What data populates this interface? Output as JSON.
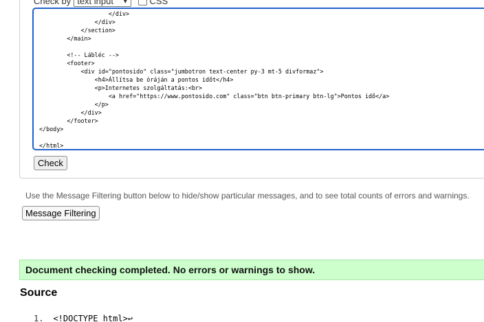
{
  "form": {
    "check_by_label": "Check by",
    "check_by_value": "text input",
    "css_label": "CSS",
    "check_button": "Check"
  },
  "code_lines": [
    "                    </div>",
    "                </div>",
    "            </section>",
    "        </main>",
    "",
    "        <!-- Lábléc -->",
    "        <footer>",
    "            <div id=\"pontosido\" class=\"jumbotron text-center py-3 mt-5 divformaz\">",
    "                <h4>Állítsa be óráján a pontos időt</h4>",
    "                <p>Internetes szolgáltatás:<br>",
    "                    <a href=\"https://www.pontosido.com\" class=\"btn btn-primary btn-lg\">Pontos idő</a>",
    "                </p>",
    "            </div>",
    "        </footer>",
    "</body>",
    "",
    "</html>"
  ],
  "hint_text": "Use the Message Filtering button below to hide/show particular messages, and to see total counts of errors and warnings.",
  "filter_button": "Message Filtering",
  "success_message": "Document checking completed. No errors or warnings to show.",
  "source_heading": "Source",
  "source_first_line": {
    "number": "1.",
    "code": "<!DOCTYPE html>↩"
  },
  "colors": {
    "focus_border": "#1f62c9",
    "success_bg": "#ccffcc"
  }
}
